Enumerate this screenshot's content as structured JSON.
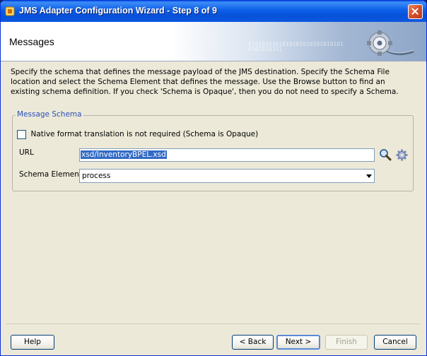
{
  "window": {
    "title": "JMS Adapter Configuration Wizard - Step 8 of 9"
  },
  "banner": {
    "title": "Messages",
    "binary": "0101010101010101010101010101\n0101010101"
  },
  "description": "Specify the schema that defines the message payload of the JMS destination.  Specify the Schema File location and select the Schema Element that defines the message. Use the Browse button to find an existing schema definition. If you check 'Schema is Opaque', then you do not need to specify a Schema.",
  "message_schema": {
    "legend": "Message Schema",
    "opaque_checkbox": {
      "label": "Native format translation is not required (Schema is Opaque)",
      "checked": false
    },
    "url": {
      "label": "URL",
      "value": "xsd/InventoryBPEL.xsd"
    },
    "schema_element": {
      "label": "Schema Element",
      "value": "process"
    }
  },
  "buttons": {
    "help": "Help",
    "back": "< Back",
    "next": "Next >",
    "finish": "Finish",
    "cancel": "Cancel"
  }
}
